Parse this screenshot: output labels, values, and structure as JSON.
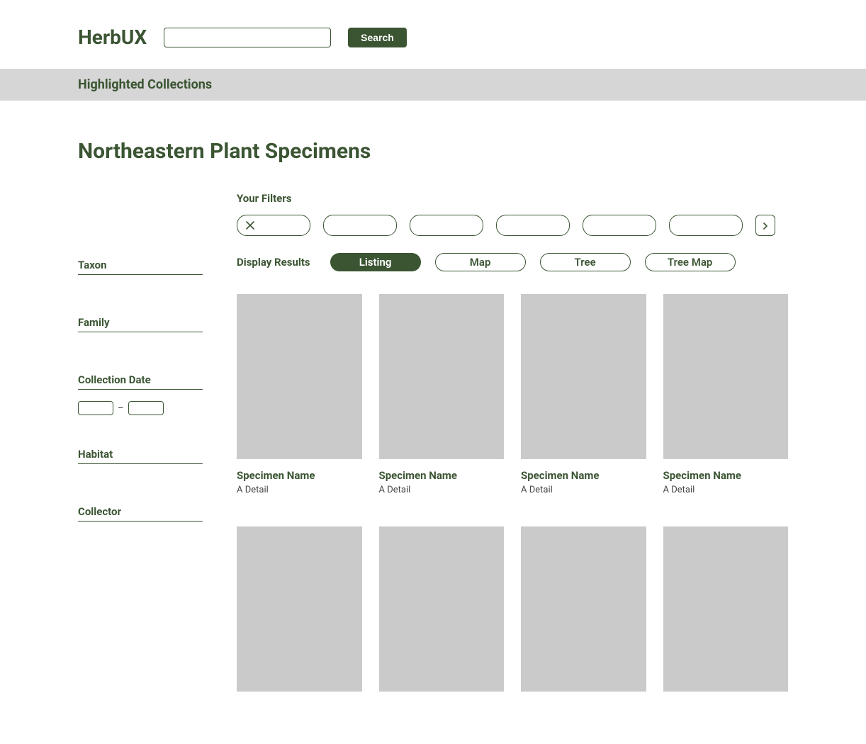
{
  "brand": {
    "logo": "HerbUX"
  },
  "header": {
    "search_value": "",
    "search_button": "Search"
  },
  "highlighted_bar": {
    "title": "Highlighted Collections"
  },
  "collection": {
    "title": "Northeastern Plant Specimens"
  },
  "sidebar": {
    "filters": [
      {
        "label": "Taxon"
      },
      {
        "label": "Family"
      },
      {
        "label": "Collection Date",
        "type": "date-range",
        "from": "",
        "to": "",
        "sep": "–"
      },
      {
        "label": "Habitat"
      },
      {
        "label": "Collector"
      }
    ]
  },
  "filters_applied": {
    "label": "Your Filters",
    "chips": [
      {
        "kind": "remove"
      },
      {
        "kind": "blank"
      },
      {
        "kind": "blank"
      },
      {
        "kind": "blank"
      },
      {
        "kind": "blank"
      },
      {
        "kind": "blank"
      },
      {
        "kind": "more"
      }
    ]
  },
  "display": {
    "label": "Display Results",
    "tabs": [
      {
        "label": "Listing",
        "active": true
      },
      {
        "label": "Map",
        "active": false
      },
      {
        "label": "Tree",
        "active": false
      },
      {
        "label": "Tree Map",
        "active": false
      }
    ]
  },
  "results": [
    {
      "name": "Specimen Name",
      "detail": "A Detail"
    },
    {
      "name": "Specimen Name",
      "detail": "A Detail"
    },
    {
      "name": "Specimen Name",
      "detail": "A Detail"
    },
    {
      "name": "Specimen Name",
      "detail": "A Detail"
    },
    {
      "name": "",
      "detail": ""
    },
    {
      "name": "",
      "detail": ""
    },
    {
      "name": "",
      "detail": ""
    },
    {
      "name": "",
      "detail": ""
    }
  ]
}
